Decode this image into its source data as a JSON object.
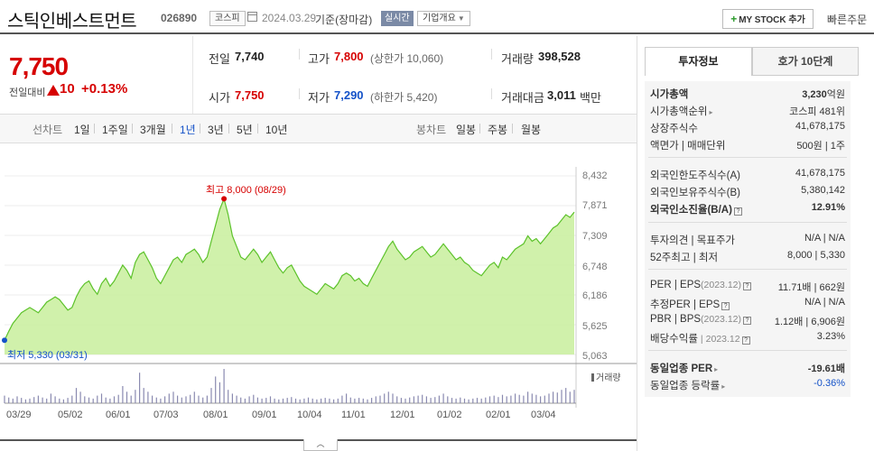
{
  "header": {
    "stock_name": "스틱인베스트먼트",
    "stock_code": "026890",
    "market_badge": "코스피",
    "date": "2024.03.29",
    "date_desc": "기준(장마감)",
    "realtime_badge": "실시간",
    "overview_label": "기업개요",
    "mystock_label": "MY STOCK 추가",
    "quick_order_label": "빠른주문"
  },
  "price": {
    "current": "7,750",
    "vs_label": "전일대비",
    "change": "10",
    "change_pct": "+0.13%"
  },
  "quote": {
    "prev_label": "전일",
    "prev": "7,740",
    "high_label": "고가",
    "high": "7,800",
    "upper_limit": "(상한가 10,060)",
    "volume_label": "거래량",
    "volume": "398,528",
    "open_label": "시가",
    "open": "7,750",
    "low_label": "저가",
    "low": "7,290",
    "lower_limit": "(하한가 5,420)",
    "amount_label": "거래대금",
    "amount": "3,011",
    "amount_unit": "백만"
  },
  "period": {
    "line_label": "선차트",
    "line_items": [
      "1일",
      "1주일",
      "3개월",
      "1년",
      "3년",
      "5년",
      "10년"
    ],
    "active": "1년",
    "candle_label": "봉차트",
    "candle_items": [
      "일봉",
      "주봉",
      "월봉"
    ]
  },
  "chart_data": {
    "type": "area",
    "title": "",
    "y_ticks": [
      "8,432",
      "7,871",
      "7,309",
      "6,748",
      "6,186",
      "5,625",
      "5,063"
    ],
    "ylim": [
      5063,
      8432
    ],
    "x_ticks": [
      "03/29",
      "05/02",
      "06/01",
      "07/03",
      "08/01",
      "09/01",
      "10/04",
      "11/01",
      "12/01",
      "01/02",
      "02/01",
      "03/04"
    ],
    "high_label": "최고 8,000 (08/29)",
    "low_label": "최저 5,330 (03/31)",
    "volume_label": "거래량",
    "series": [
      {
        "values": [
          5330,
          5500,
          5650,
          5750,
          5850,
          5900,
          5950,
          5900,
          5850,
          5950,
          6050,
          6100,
          6150,
          6100,
          6000,
          5900,
          5950,
          6150,
          6300,
          6400,
          6450,
          6300,
          6200,
          6400,
          6500,
          6350,
          6450,
          6600,
          6750,
          6650,
          6500,
          6800,
          6950,
          7000,
          6850,
          6700,
          6500,
          6400,
          6550,
          6700,
          6850,
          6900,
          6800,
          6950,
          7000,
          7050,
          6950,
          6800,
          6900,
          7200,
          7500,
          7800,
          8000,
          7700,
          7300,
          7100,
          6900,
          6850,
          6950,
          7050,
          6950,
          6800,
          6900,
          7000,
          6850,
          6700,
          6600,
          6700,
          6750,
          6600,
          6450,
          6350,
          6300,
          6250,
          6200,
          6300,
          6400,
          6350,
          6300,
          6400,
          6550,
          6600,
          6550,
          6450,
          6500,
          6400,
          6350,
          6500,
          6650,
          6800,
          6950,
          7100,
          7200,
          7050,
          6950,
          6850,
          6900,
          7000,
          7050,
          7100,
          7000,
          6900,
          6950,
          7050,
          7150,
          7050,
          6950,
          6850,
          6900,
          6800,
          6750,
          6650,
          6600,
          6550,
          6650,
          6750,
          6800,
          6700,
          6900,
          6850,
          6950,
          7050,
          7100,
          7150,
          7300,
          7200,
          7250,
          7150,
          7250,
          7350,
          7450,
          7500,
          7600,
          7700,
          7650,
          7750
        ],
        "volumes": [
          20,
          15,
          12,
          18,
          14,
          10,
          12,
          16,
          20,
          15,
          12,
          25,
          18,
          12,
          10,
          14,
          20,
          40,
          30,
          18,
          15,
          12,
          20,
          25,
          15,
          12,
          18,
          22,
          45,
          30,
          20,
          35,
          80,
          40,
          30,
          20,
          15,
          12,
          18,
          25,
          30,
          20,
          15,
          18,
          22,
          30,
          20,
          15,
          20,
          40,
          70,
          55,
          90,
          35,
          25,
          20,
          15,
          12,
          18,
          22,
          15,
          12,
          14,
          18,
          12,
          10,
          12,
          14,
          16,
          12,
          10,
          12,
          15,
          12,
          10,
          12,
          14,
          12,
          10,
          12,
          20,
          25,
          15,
          12,
          14,
          12,
          10,
          14,
          18,
          20,
          25,
          30,
          25,
          18,
          14,
          12,
          15,
          18,
          20,
          22,
          18,
          14,
          16,
          20,
          25,
          18,
          14,
          12,
          15,
          12,
          10,
          12,
          14,
          12,
          15,
          18,
          20,
          16,
          22,
          18,
          20,
          25,
          22,
          20,
          30,
          25,
          22,
          18,
          20,
          25,
          30,
          28,
          35,
          40,
          30,
          35
        ]
      }
    ]
  },
  "info": {
    "tab_invest": "투자정보",
    "tab_orderbook": "호가 10단계",
    "market_cap_label": "시가총액",
    "market_cap": "3,230",
    "market_cap_unit": "억원",
    "market_cap_rank_label": "시가총액순위",
    "market_cap_rank": "코스피 481위",
    "shares_label": "상장주식수",
    "shares": "41,678,175",
    "par_label": "액면가 | 매매단위",
    "par": "500원 | 1주",
    "foreign_limit_label": "외국인한도주식수(A)",
    "foreign_limit": "41,678,175",
    "foreign_hold_label": "외국인보유주식수(B)",
    "foreign_hold": "5,380,142",
    "foreign_ratio_label": "외국인소진율(B/A)",
    "foreign_ratio": "12.91%",
    "opinion_label": "투자의견 | 목표주가",
    "opinion": "N/A | N/A",
    "week52_label": "52주최고 | 최저",
    "week52": "8,000 | 5,330",
    "per_label": "PER | EPS",
    "per_date": "(2023.12)",
    "per": "11.71배 | 662원",
    "est_per_label": "추정PER | EPS",
    "est_per": "N/A | N/A",
    "pbr_label": "PBR | BPS",
    "pbr_date": "(2023.12)",
    "pbr": "1.12배 | 6,906원",
    "dividend_label": "배당수익률",
    "dividend_date": "2023.12",
    "dividend": "3.23%",
    "industry_per_label": "동일업종 PER",
    "industry_per": "-19.61배",
    "industry_chg_label": "동일업종 등락률",
    "industry_chg": "-0.36%"
  },
  "colors": {
    "up": "#d60000",
    "down": "#1452c8",
    "area_fill": "#c8ef9c",
    "area_line": "#5cc22a"
  }
}
